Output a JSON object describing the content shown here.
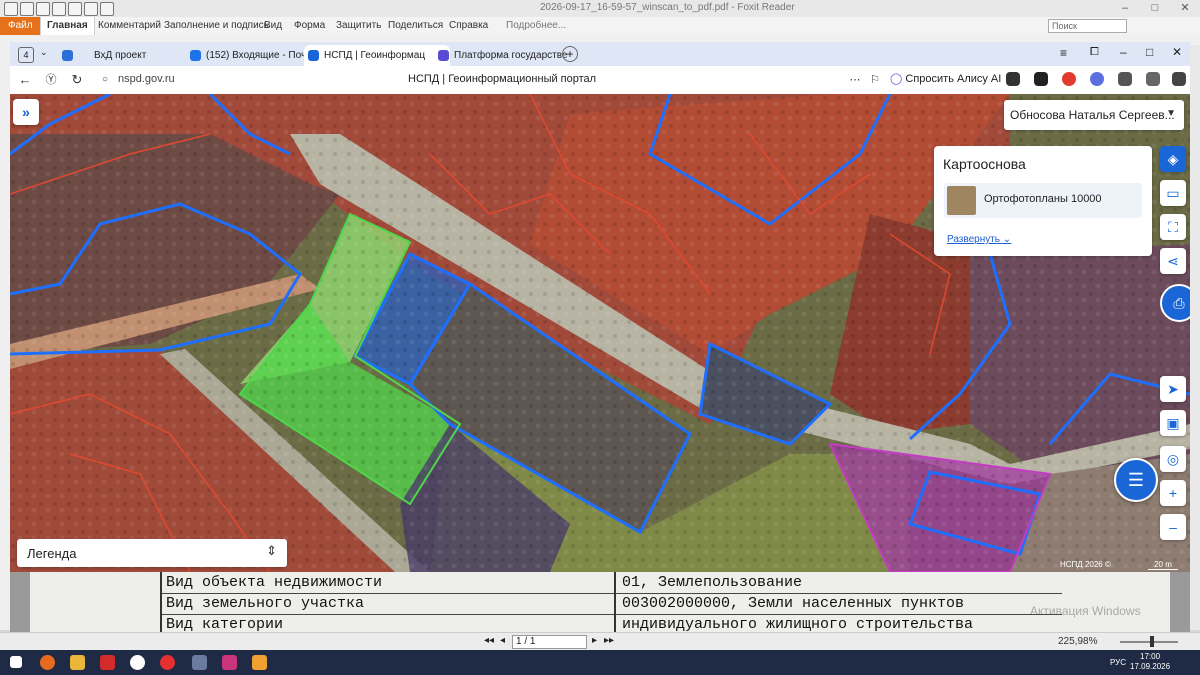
{
  "foxit": {
    "title": "2026-09-17_16-59-57_winscan_to_pdf.pdf - Foxit Reader",
    "ribbon_tabs": [
      "Файл",
      "Главная",
      "Комментарий",
      "Заполнение и подпись",
      "Вид",
      "Форма",
      "Защитить",
      "Поделиться",
      "Справка",
      "Подробнее..."
    ],
    "search_placeholder": "Поиск",
    "page_field": "1 / 1",
    "zoom": "225,98%"
  },
  "browser": {
    "tab_count": "4",
    "tabs": [
      {
        "label": "ВхД проект",
        "color": "#2b6fd6"
      },
      {
        "label": "(152) Входящие - Почта М",
        "color": "#1e73e8"
      },
      {
        "label": "НСПД | Геоинформац",
        "color": "#1a66d6"
      },
      {
        "label": "Платформа государстве",
        "color": "#5a4bd6"
      }
    ],
    "url": "nspd.gov.ru",
    "page_title": "НСПД | Геоинформационный портал",
    "alice_label": "Спросить Алису AI"
  },
  "map": {
    "user_name": "Обносова Наталья Сергеев...",
    "basemap_title": "Картооснова",
    "basemap_item": "Ортофотопланы 10000",
    "basemap_expand": "Развернуть",
    "legend_label": "Легенда",
    "copyright": "НСПД 2026 ©",
    "scale": "20 m",
    "colors": {
      "cadastral_blue": "#1f6fff",
      "parcel_red": "#e0492f",
      "selected_green": "#4fd64a",
      "zone_magenta": "#c43cc4"
    }
  },
  "document": {
    "rows": [
      {
        "label": "Вид объекта недвижимости",
        "value": "01, Землепользование"
      },
      {
        "label": "Вид земельного участка",
        "value": "003002000000, Земли населенных пунктов"
      },
      {
        "label": "Вид категории",
        "value": "индивидуального жилищного строительства"
      }
    ],
    "activation": "Активация Windows"
  },
  "taskbar": {
    "lang": "РУС",
    "time": "17:00",
    "date": "17.09.2026"
  }
}
